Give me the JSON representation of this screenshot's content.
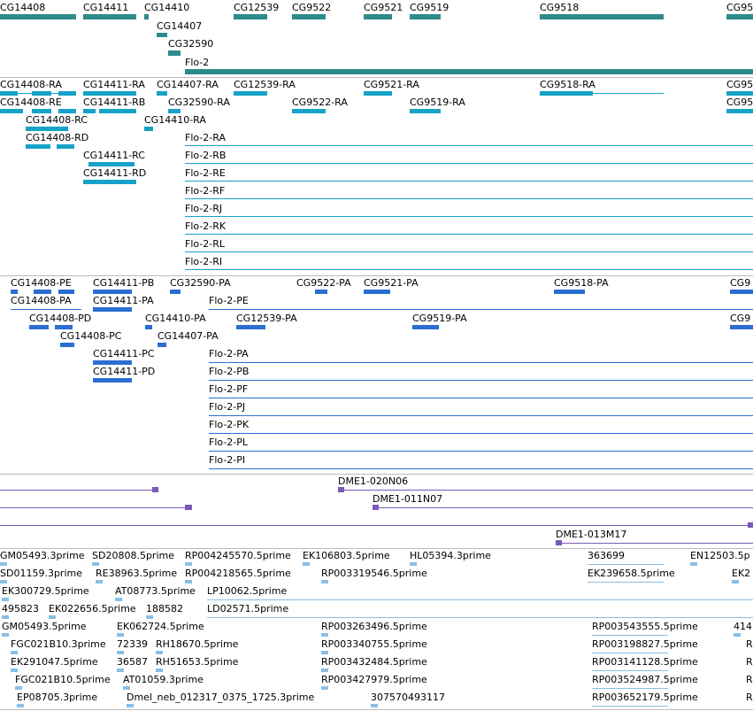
{
  "tracks": {
    "genes": [
      "CG14408",
      "CG14411",
      "CG14410",
      "CG14407",
      "CG32590",
      "CG12539",
      "CG9522",
      "CG9521",
      "CG9519",
      "CG9518",
      "Flo-2",
      "CG95"
    ],
    "transcripts": [
      "CG14408-RA",
      "CG14408-RE",
      "CG14408-RC",
      "CG14408-RD",
      "CG14411-RA",
      "CG14411-RB",
      "CG14411-RC",
      "CG14411-RD",
      "CG14407-RA",
      "CG32590-RA",
      "CG14410-RA",
      "CG12539-RA",
      "CG9522-RA",
      "CG9521-RA",
      "CG9519-RA",
      "CG9518-RA",
      "CG95",
      "CG95",
      "Flo-2-RA",
      "Flo-2-RB",
      "Flo-2-RE",
      "Flo-2-RF",
      "Flo-2-RJ",
      "Flo-2-RK",
      "Flo-2-RL",
      "Flo-2-RI"
    ],
    "proteins": [
      "CG14408-PE",
      "CG14408-PA",
      "CG14408-PD",
      "CG14408-PC",
      "CG14411-PB",
      "CG14411-PA",
      "CG14411-PC",
      "CG14411-PD",
      "CG32590-PA",
      "Flo-2-PE",
      "CG14410-PA",
      "CG14407-PA",
      "CG12539-PA",
      "CG9522-PA",
      "CG9521-PA",
      "CG9519-PA",
      "CG9518-PA",
      "CG9",
      "CG9",
      "Flo-2-PA",
      "Flo-2-PB",
      "Flo-2-PF",
      "Flo-2-PJ",
      "Flo-2-PK",
      "Flo-2-PL",
      "Flo-2-PI"
    ],
    "bacs": [
      "DME1-020N06",
      "DME1-011N07",
      "DME1-013M17"
    ],
    "ests": [
      "GM05493.3prime",
      "SD20808.5prime",
      "RP004245570.5prime",
      "EK106803.5prime",
      "HL05394.3prime",
      "363699",
      "EN12503.5p",
      "SD01159.3prime",
      "RE38963.5prime",
      "RP004218565.5prime",
      "RP003319546.5prime",
      "EK239658.5prime",
      "EK2",
      "EK300729.5prime",
      "AT08773.5prime",
      "LP10062.5prime",
      "495823",
      "EK022656.5prime",
      "188582",
      "LD02571.5prime",
      "GM05493.5prime",
      "EK062724.5prime",
      "RP003263496.5prime",
      "RP003543555.5prime",
      "414",
      "FGC021B10.3prime",
      "72339",
      "RH18670.5prime",
      "RP003340755.5prime",
      "RP003198827.5prime",
      "R",
      "EK291047.5prime",
      "36587",
      "RH51653.5prime",
      "RP003432484.5prime",
      "RP003141128.5prime",
      "R",
      "FGC021B10.5prime",
      "AT01059.3prime",
      "RP003427979.5prime",
      "RP003524987.5prime",
      "R",
      "EP08705.3prime",
      "Dmel_neb_012317_0375_1725.3prime",
      "307570493117",
      "RP003652179.5prime",
      "R"
    ]
  },
  "colors": {
    "gene": "#2e8b8b",
    "transcript": "#17a2c8",
    "protein": "#2a6fd1",
    "bac": "#7a5ab8",
    "est": "#88bfe6"
  }
}
